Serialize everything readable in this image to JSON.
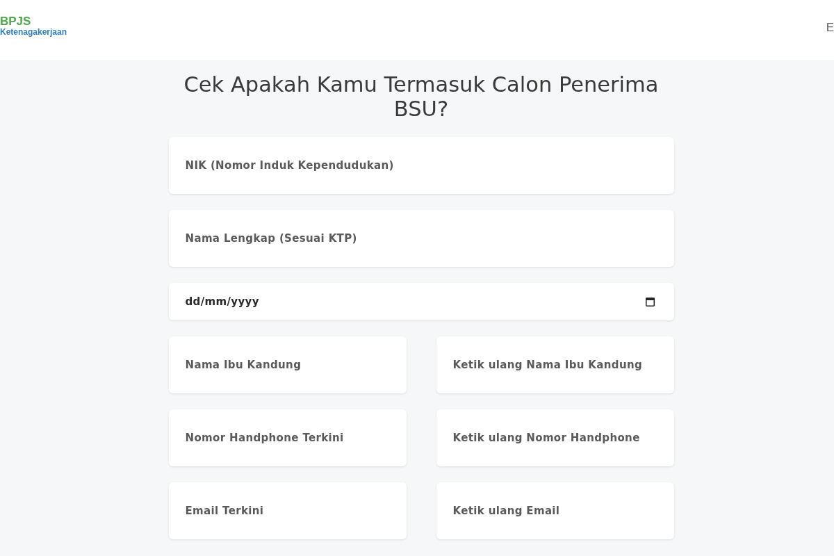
{
  "header": {
    "logo": {
      "title": "BPJS",
      "subtitle": "Ketenagakerjaan"
    },
    "nav_text": "E"
  },
  "form": {
    "title": "Cek Apakah Kamu Termasuk Calon Penerima BSU?",
    "rows": [
      {
        "fields": [
          {
            "kind": "text",
            "placeholder": "NIK (Nomor Induk Kependudukan)"
          }
        ]
      },
      {
        "fields": [
          {
            "kind": "text",
            "placeholder": "Nama Lengkap (Sesuai KTP)"
          }
        ]
      },
      {
        "fields": [
          {
            "kind": "date",
            "placeholder": "dd/mm/yyyy"
          }
        ]
      },
      {
        "fields": [
          {
            "kind": "text",
            "placeholder": "Nama Ibu Kandung"
          },
          {
            "kind": "text",
            "placeholder": "Ketik ulang Nama Ibu Kandung"
          }
        ]
      },
      {
        "fields": [
          {
            "kind": "text",
            "placeholder": "Nomor Handphone Terkini"
          },
          {
            "kind": "text",
            "placeholder": "Ketik ulang Nomor Handphone"
          }
        ]
      },
      {
        "fields": [
          {
            "kind": "text",
            "placeholder": "Email Terkini"
          },
          {
            "kind": "text",
            "placeholder": "Ketik ulang Email"
          }
        ]
      }
    ]
  }
}
